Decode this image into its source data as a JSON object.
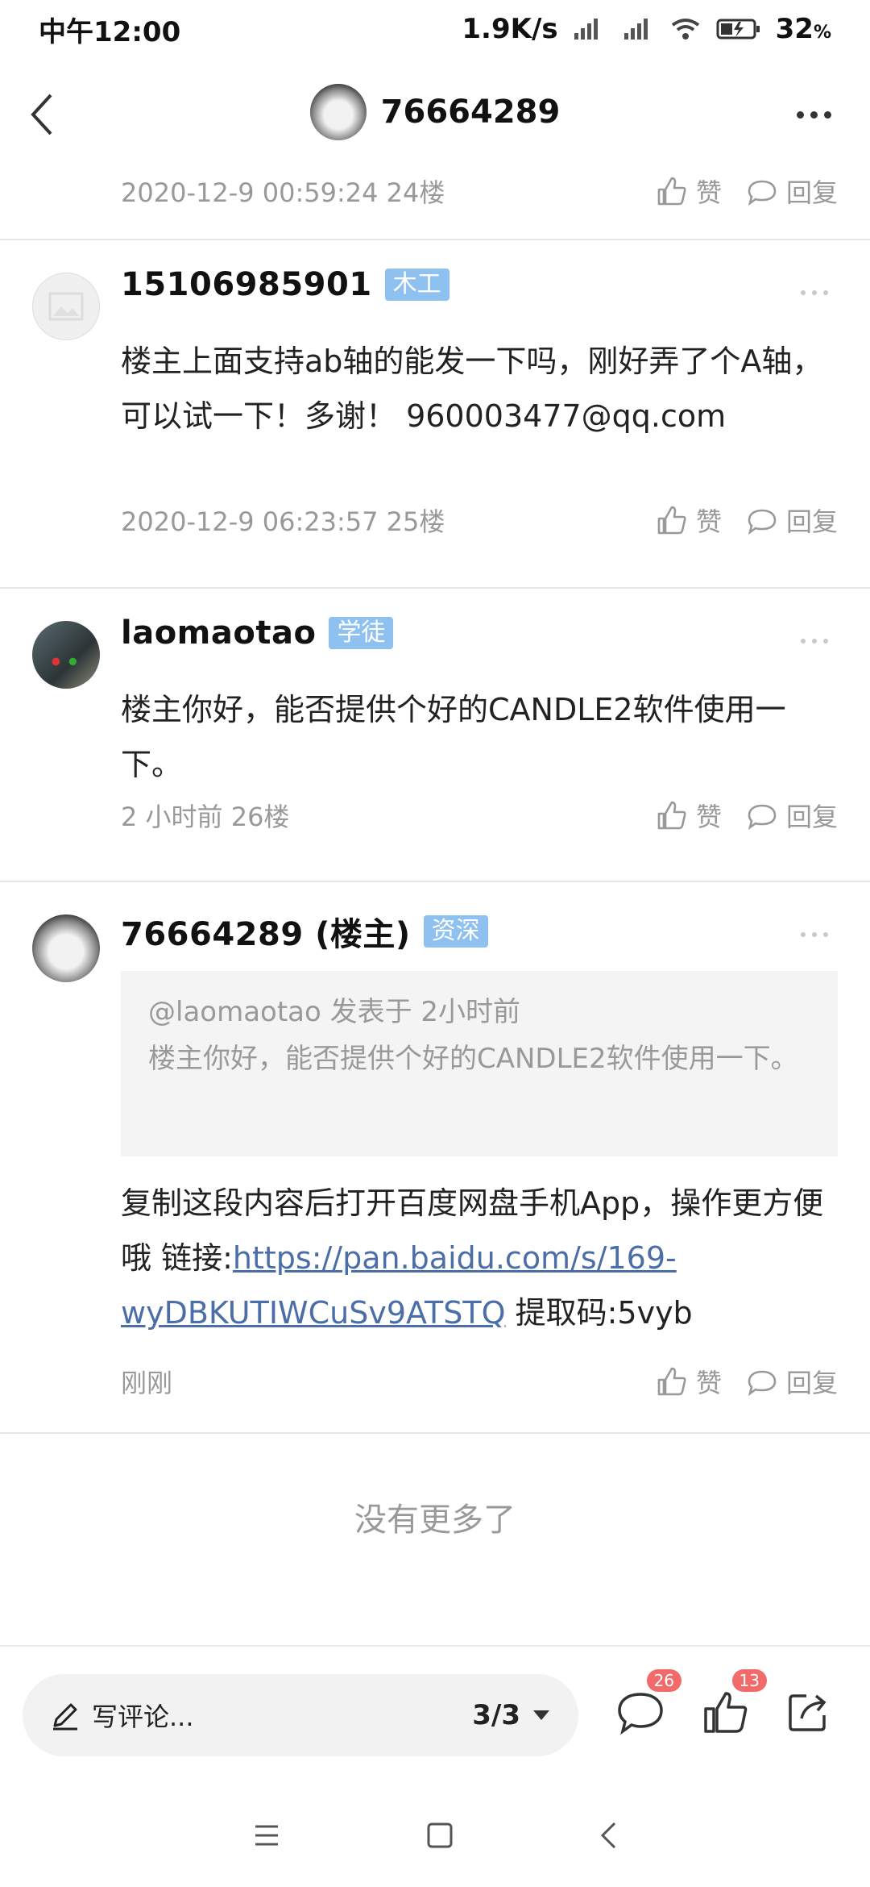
{
  "status_bar": {
    "time": "中午12:00",
    "speed": "1.9K/s",
    "battery": "32"
  },
  "header": {
    "title": "76664289"
  },
  "posts": [
    {
      "meta": "2020-12-9 00:59:24  24楼",
      "like": "赞",
      "reply": "回复"
    },
    {
      "name": "15106985901",
      "badge": "木工",
      "body": "楼主上面支持ab轴的能发一下吗，刚好弄了个A轴，可以试一下！多谢！   960003477@qq.com",
      "meta": "2020-12-9 06:23:57  25楼",
      "like": "赞",
      "reply": "回复"
    },
    {
      "name": "laomaotao",
      "badge": "学徒",
      "body": "楼主你好，能否提供个好的CANDLE2软件使用一下。",
      "meta": "2 小时前  26楼",
      "like": "赞",
      "reply": "回复"
    },
    {
      "name": "76664289 (楼主)",
      "badge": "资深",
      "quote_head": "@laomaotao 发表于 2小时前",
      "quote_body": "楼主你好，能否提供个好的CANDLE2软件使用一下。",
      "body_prefix": "复制这段内容后打开百度网盘手机App，操作更方便哦 链接:",
      "link": "https://pan.baidu.com/s/169-wyDBKUTIWCuSv9ATSTQ",
      "body_suffix": " 提取码:5vyb",
      "meta": "刚刚",
      "like": "赞",
      "reply": "回复"
    }
  ],
  "footer_note": "没有更多了",
  "bottom_bar": {
    "placeholder": "写评论...",
    "page": "3/3",
    "comment_count": "26",
    "like_count": "13"
  }
}
